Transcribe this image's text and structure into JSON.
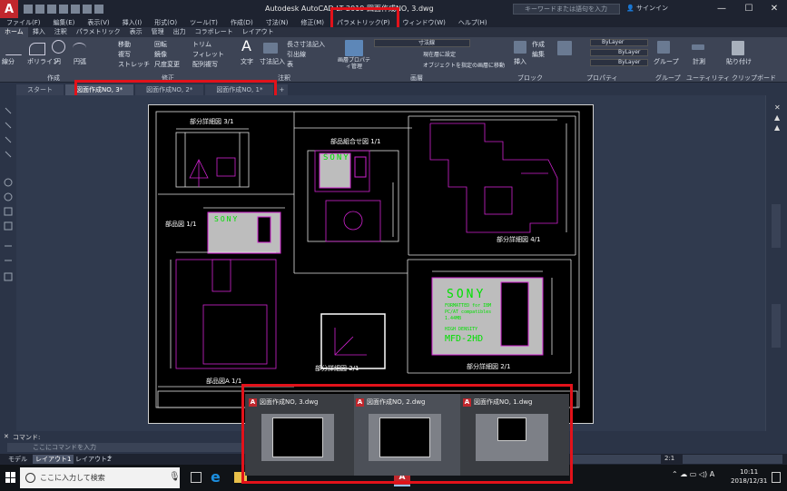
{
  "window": {
    "title": "Autodesk AutoCAD LT 2019   図面作成NO, 3.dwg",
    "search_placeholder": "キーワードまたは語句を入力",
    "signin": "サインイン"
  },
  "menubar": [
    "ファイル(F)",
    "編集(E)",
    "表示(V)",
    "挿入(I)",
    "形式(O)",
    "ツール(T)",
    "作成(D)",
    "寸法(N)",
    "修正(M)",
    "パラメトリック(P)",
    "ウィンドウ(W)",
    "ヘルプ(H)"
  ],
  "ribbon_tabs": [
    "ホーム",
    "挿入",
    "注釈",
    "パラメトリック",
    "表示",
    "管理",
    "出力",
    "コラボレート",
    "レイアウト"
  ],
  "ribbon": {
    "groups": [
      "作成",
      "修正",
      "注釈",
      "画層",
      "ブロック",
      "プロパティ",
      "グループ",
      "ユーティリティ",
      "クリップボード"
    ],
    "draw_tools": [
      "線分",
      "ポリライン",
      "円",
      "円弧"
    ],
    "modify_tools": [
      "移動",
      "回転",
      "トリム",
      "複写",
      "鏡像",
      "フィレット",
      "ストレッチ",
      "尺度変更",
      "配列複写"
    ],
    "annotate_tools": [
      "文字",
      "寸法記入",
      "引出線",
      "表",
      "長さ寸法記入"
    ],
    "layer_tools": [
      "画層プロパティ管理",
      "寸法線",
      "現在層に設定",
      "オブジェクトを指定の画層に移動"
    ],
    "block_tools": [
      "挿入",
      "作成",
      "編集"
    ],
    "properties": [
      "ByLayer",
      "ByLayer",
      "ByLayer"
    ],
    "other_tools": [
      "グループ",
      "計測",
      "貼り付け"
    ]
  },
  "file_tabs": [
    "スタート",
    "図面作成NO, 3*",
    "図面作成NO, 2*",
    "図面作成NO, 1*"
  ],
  "drawing": {
    "views": [
      "部分詳細図 3/1",
      "部品組合せ図 1/1",
      "部分詳細図 4/1",
      "部品図 1/1",
      "部品図A 1/1",
      "部分詳細図 2/1",
      "部分詳細図 2/1"
    ],
    "disk_brand": "SONY",
    "disk_lines": [
      "FORMATTED for IBM",
      "PC/AT compatibles",
      "1.44MB",
      "HIGH DENSITY",
      "MFD-2HD"
    ]
  },
  "previews": [
    {
      "name": "図面作成NO, 3.dwg"
    },
    {
      "name": "図面作成NO, 2.dwg"
    },
    {
      "name": "図面作成NO, 1.dwg"
    }
  ],
  "command": {
    "label": "コマンド:",
    "placeholder": "ここにコマンドを入力"
  },
  "layout_tabs": [
    "モデル",
    "レイアウト1",
    "レイアウト2"
  ],
  "status": {
    "scale": "2:1"
  },
  "taskbar": {
    "search": "ここに入力して検索",
    "time": "10:11",
    "date": "2018/12/31"
  },
  "colors": {
    "highlight": "#e2121a",
    "autocad_red": "#c1272d"
  }
}
